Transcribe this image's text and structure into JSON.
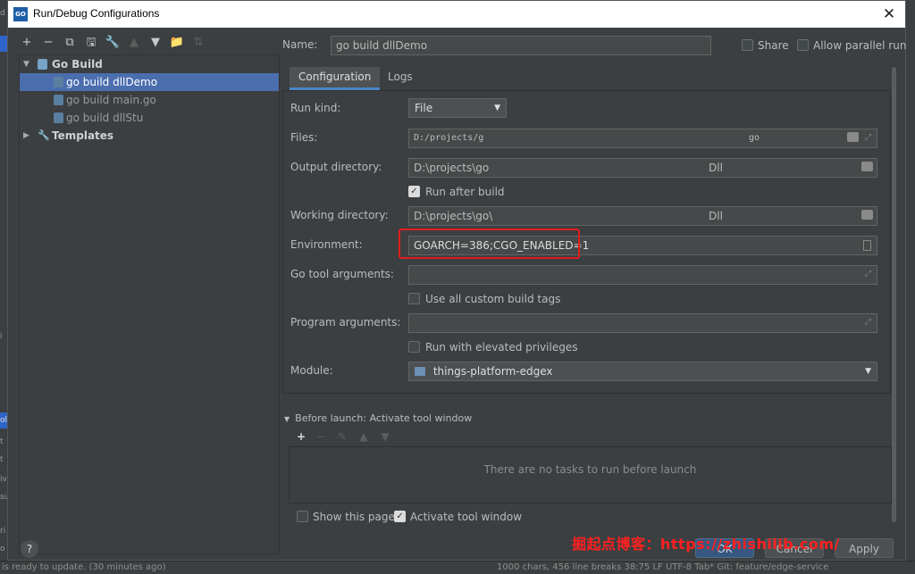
{
  "window": {
    "title": "Run/Debug Configurations",
    "app_icon": "GO",
    "close_symbol": "✕"
  },
  "ide": {
    "left_fragments": [
      "d",
      "i",
      "ol",
      "t",
      "t",
      "iv",
      "su",
      "ri",
      "o"
    ],
    "status_text": "is ready to update. (30 minutes ago)",
    "status_right": "1000 chars, 456 line breaks   38:75   LF   UTF-8   Tab*   Git: feature/edge-service"
  },
  "toolbar": {
    "add": "+",
    "remove": "−",
    "copy": "⧉",
    "save": "🖫",
    "edit": "🔧",
    "up": "▲",
    "down": "▼",
    "folder": "📁",
    "sort": "⇅"
  },
  "tree": {
    "group": "Go Build",
    "items": [
      "go build dllDemo",
      "go build main.go",
      "go build dllStu"
    ],
    "templates": "Templates"
  },
  "name": {
    "label": "Name:",
    "value": "go build dllDemo"
  },
  "share": {
    "label": "Share"
  },
  "parallel": {
    "label": "Allow parallel run"
  },
  "tabs": [
    "Configuration",
    "Logs"
  ],
  "config": {
    "run_kind": {
      "label": "Run kind:",
      "value": "File"
    },
    "files": {
      "label": "Files:",
      "value_start": "D:/projects/g",
      "value_end": "go"
    },
    "output_directory": {
      "label": "Output directory:",
      "value_start": "D:\\projects\\go",
      "value_end": "Dll"
    },
    "run_after_build": {
      "label": "Run after build",
      "checked": true
    },
    "working_directory": {
      "label": "Working directory:",
      "value_start": "D:\\projects\\go\\",
      "value_end": "Dll"
    },
    "environment": {
      "label": "Environment:",
      "value": "GOARCH=386;CGO_ENABLED=1"
    },
    "go_tool_arguments": {
      "label": "Go tool arguments:",
      "value": ""
    },
    "use_custom_build_tags": {
      "label": "Use all custom build tags",
      "checked": false
    },
    "program_arguments": {
      "label": "Program arguments:",
      "value": ""
    },
    "elevated_privileges": {
      "label": "Run with elevated privileges",
      "checked": false
    },
    "module": {
      "label": "Module:",
      "value": "things-platform-edgex"
    }
  },
  "before_launch": {
    "header": "Before launch: Activate tool window",
    "empty_message": "There are no tasks to run before launch",
    "toolbar": [
      "+",
      "−",
      "✎",
      "▲",
      "▼"
    ]
  },
  "footer": {
    "show_this_page": {
      "label": "Show this page",
      "checked": false
    },
    "activate_tool_window": {
      "label": "Activate tool window",
      "checked": true
    },
    "help": "?",
    "ok": "OK",
    "cancel": "Cancel",
    "apply": "Apply"
  },
  "watermark": "掘起点博客：https://zhishilib.com/",
  "colors": {
    "selection": "#4b6eaf",
    "highlight_box": "#e21c1c",
    "tab_underline": "#4a88c7"
  }
}
